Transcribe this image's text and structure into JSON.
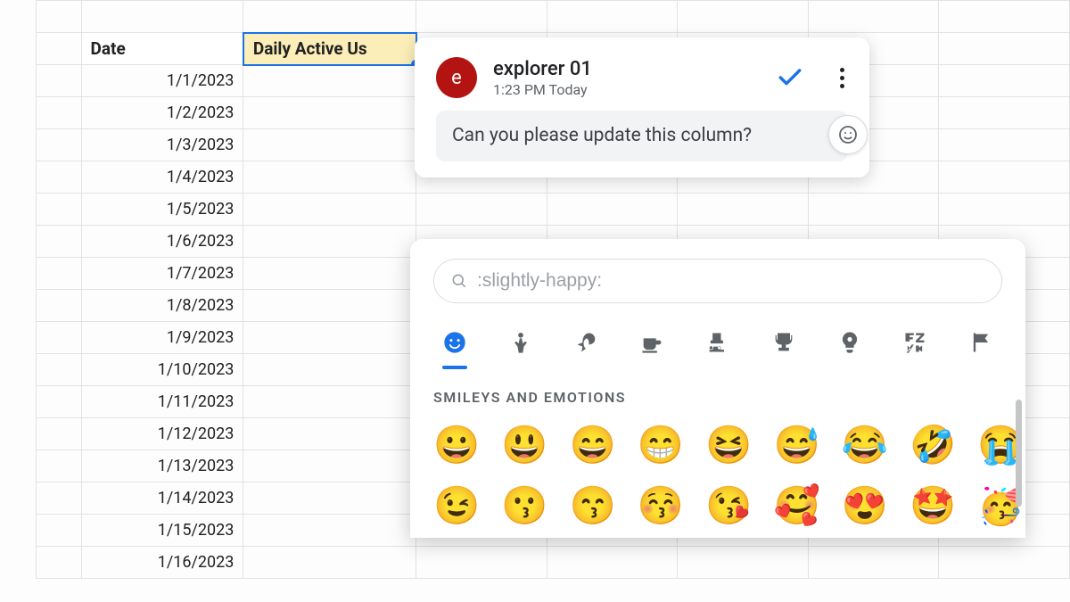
{
  "spreadsheet": {
    "headers": {
      "date": "Date",
      "dau": "Daily Active Us"
    },
    "rows": [
      "1/1/2023",
      "1/2/2023",
      "1/3/2023",
      "1/4/2023",
      "1/5/2023",
      "1/6/2023",
      "1/7/2023",
      "1/8/2023",
      "1/9/2023",
      "1/10/2023",
      "1/11/2023",
      "1/12/2023",
      "1/13/2023",
      "1/14/2023",
      "1/15/2023",
      "1/16/2023"
    ]
  },
  "comment": {
    "avatar_letter": "e",
    "user": "explorer 01",
    "time": "1:23 PM Today",
    "text": "Can you please update this column?"
  },
  "picker": {
    "search_value": ":slightly-happy:",
    "section": "SMILEYS AND EMOTIONS",
    "categories": [
      "smileys",
      "people",
      "nature",
      "food",
      "travel",
      "activities",
      "objects",
      "symbols",
      "flags"
    ],
    "emojis_row1": [
      "😀",
      "😃",
      "😄",
      "😁",
      "😆",
      "😅",
      "😂",
      "🤣",
      "😭"
    ],
    "emojis_row2": [
      "😉",
      "😗",
      "😙",
      "😚",
      "😘",
      "🥰",
      "😍",
      "🤩",
      "🥳"
    ]
  }
}
